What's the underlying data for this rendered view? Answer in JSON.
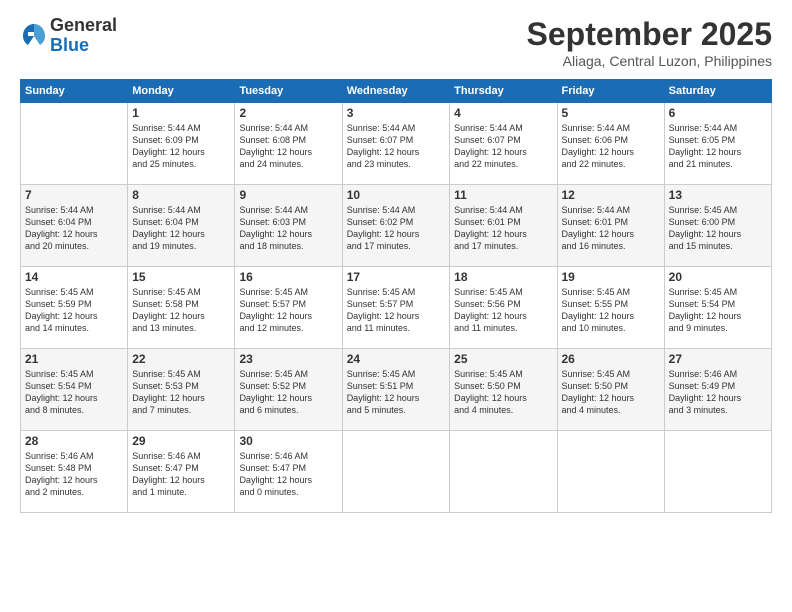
{
  "logo": {
    "general": "General",
    "blue": "Blue"
  },
  "title": "September 2025",
  "location": "Aliaga, Central Luzon, Philippines",
  "days_of_week": [
    "Sunday",
    "Monday",
    "Tuesday",
    "Wednesday",
    "Thursday",
    "Friday",
    "Saturday"
  ],
  "weeks": [
    [
      {
        "day": "",
        "info": ""
      },
      {
        "day": "1",
        "info": "Sunrise: 5:44 AM\nSunset: 6:09 PM\nDaylight: 12 hours\nand 25 minutes."
      },
      {
        "day": "2",
        "info": "Sunrise: 5:44 AM\nSunset: 6:08 PM\nDaylight: 12 hours\nand 24 minutes."
      },
      {
        "day": "3",
        "info": "Sunrise: 5:44 AM\nSunset: 6:07 PM\nDaylight: 12 hours\nand 23 minutes."
      },
      {
        "day": "4",
        "info": "Sunrise: 5:44 AM\nSunset: 6:07 PM\nDaylight: 12 hours\nand 22 minutes."
      },
      {
        "day": "5",
        "info": "Sunrise: 5:44 AM\nSunset: 6:06 PM\nDaylight: 12 hours\nand 22 minutes."
      },
      {
        "day": "6",
        "info": "Sunrise: 5:44 AM\nSunset: 6:05 PM\nDaylight: 12 hours\nand 21 minutes."
      }
    ],
    [
      {
        "day": "7",
        "info": "Sunrise: 5:44 AM\nSunset: 6:04 PM\nDaylight: 12 hours\nand 20 minutes."
      },
      {
        "day": "8",
        "info": "Sunrise: 5:44 AM\nSunset: 6:04 PM\nDaylight: 12 hours\nand 19 minutes."
      },
      {
        "day": "9",
        "info": "Sunrise: 5:44 AM\nSunset: 6:03 PM\nDaylight: 12 hours\nand 18 minutes."
      },
      {
        "day": "10",
        "info": "Sunrise: 5:44 AM\nSunset: 6:02 PM\nDaylight: 12 hours\nand 17 minutes."
      },
      {
        "day": "11",
        "info": "Sunrise: 5:44 AM\nSunset: 6:01 PM\nDaylight: 12 hours\nand 17 minutes."
      },
      {
        "day": "12",
        "info": "Sunrise: 5:44 AM\nSunset: 6:01 PM\nDaylight: 12 hours\nand 16 minutes."
      },
      {
        "day": "13",
        "info": "Sunrise: 5:45 AM\nSunset: 6:00 PM\nDaylight: 12 hours\nand 15 minutes."
      }
    ],
    [
      {
        "day": "14",
        "info": "Sunrise: 5:45 AM\nSunset: 5:59 PM\nDaylight: 12 hours\nand 14 minutes."
      },
      {
        "day": "15",
        "info": "Sunrise: 5:45 AM\nSunset: 5:58 PM\nDaylight: 12 hours\nand 13 minutes."
      },
      {
        "day": "16",
        "info": "Sunrise: 5:45 AM\nSunset: 5:57 PM\nDaylight: 12 hours\nand 12 minutes."
      },
      {
        "day": "17",
        "info": "Sunrise: 5:45 AM\nSunset: 5:57 PM\nDaylight: 12 hours\nand 11 minutes."
      },
      {
        "day": "18",
        "info": "Sunrise: 5:45 AM\nSunset: 5:56 PM\nDaylight: 12 hours\nand 11 minutes."
      },
      {
        "day": "19",
        "info": "Sunrise: 5:45 AM\nSunset: 5:55 PM\nDaylight: 12 hours\nand 10 minutes."
      },
      {
        "day": "20",
        "info": "Sunrise: 5:45 AM\nSunset: 5:54 PM\nDaylight: 12 hours\nand 9 minutes."
      }
    ],
    [
      {
        "day": "21",
        "info": "Sunrise: 5:45 AM\nSunset: 5:54 PM\nDaylight: 12 hours\nand 8 minutes."
      },
      {
        "day": "22",
        "info": "Sunrise: 5:45 AM\nSunset: 5:53 PM\nDaylight: 12 hours\nand 7 minutes."
      },
      {
        "day": "23",
        "info": "Sunrise: 5:45 AM\nSunset: 5:52 PM\nDaylight: 12 hours\nand 6 minutes."
      },
      {
        "day": "24",
        "info": "Sunrise: 5:45 AM\nSunset: 5:51 PM\nDaylight: 12 hours\nand 5 minutes."
      },
      {
        "day": "25",
        "info": "Sunrise: 5:45 AM\nSunset: 5:50 PM\nDaylight: 12 hours\nand 4 minutes."
      },
      {
        "day": "26",
        "info": "Sunrise: 5:45 AM\nSunset: 5:50 PM\nDaylight: 12 hours\nand 4 minutes."
      },
      {
        "day": "27",
        "info": "Sunrise: 5:46 AM\nSunset: 5:49 PM\nDaylight: 12 hours\nand 3 minutes."
      }
    ],
    [
      {
        "day": "28",
        "info": "Sunrise: 5:46 AM\nSunset: 5:48 PM\nDaylight: 12 hours\nand 2 minutes."
      },
      {
        "day": "29",
        "info": "Sunrise: 5:46 AM\nSunset: 5:47 PM\nDaylight: 12 hours\nand 1 minute."
      },
      {
        "day": "30",
        "info": "Sunrise: 5:46 AM\nSunset: 5:47 PM\nDaylight: 12 hours\nand 0 minutes."
      },
      {
        "day": "",
        "info": ""
      },
      {
        "day": "",
        "info": ""
      },
      {
        "day": "",
        "info": ""
      },
      {
        "day": "",
        "info": ""
      }
    ]
  ]
}
